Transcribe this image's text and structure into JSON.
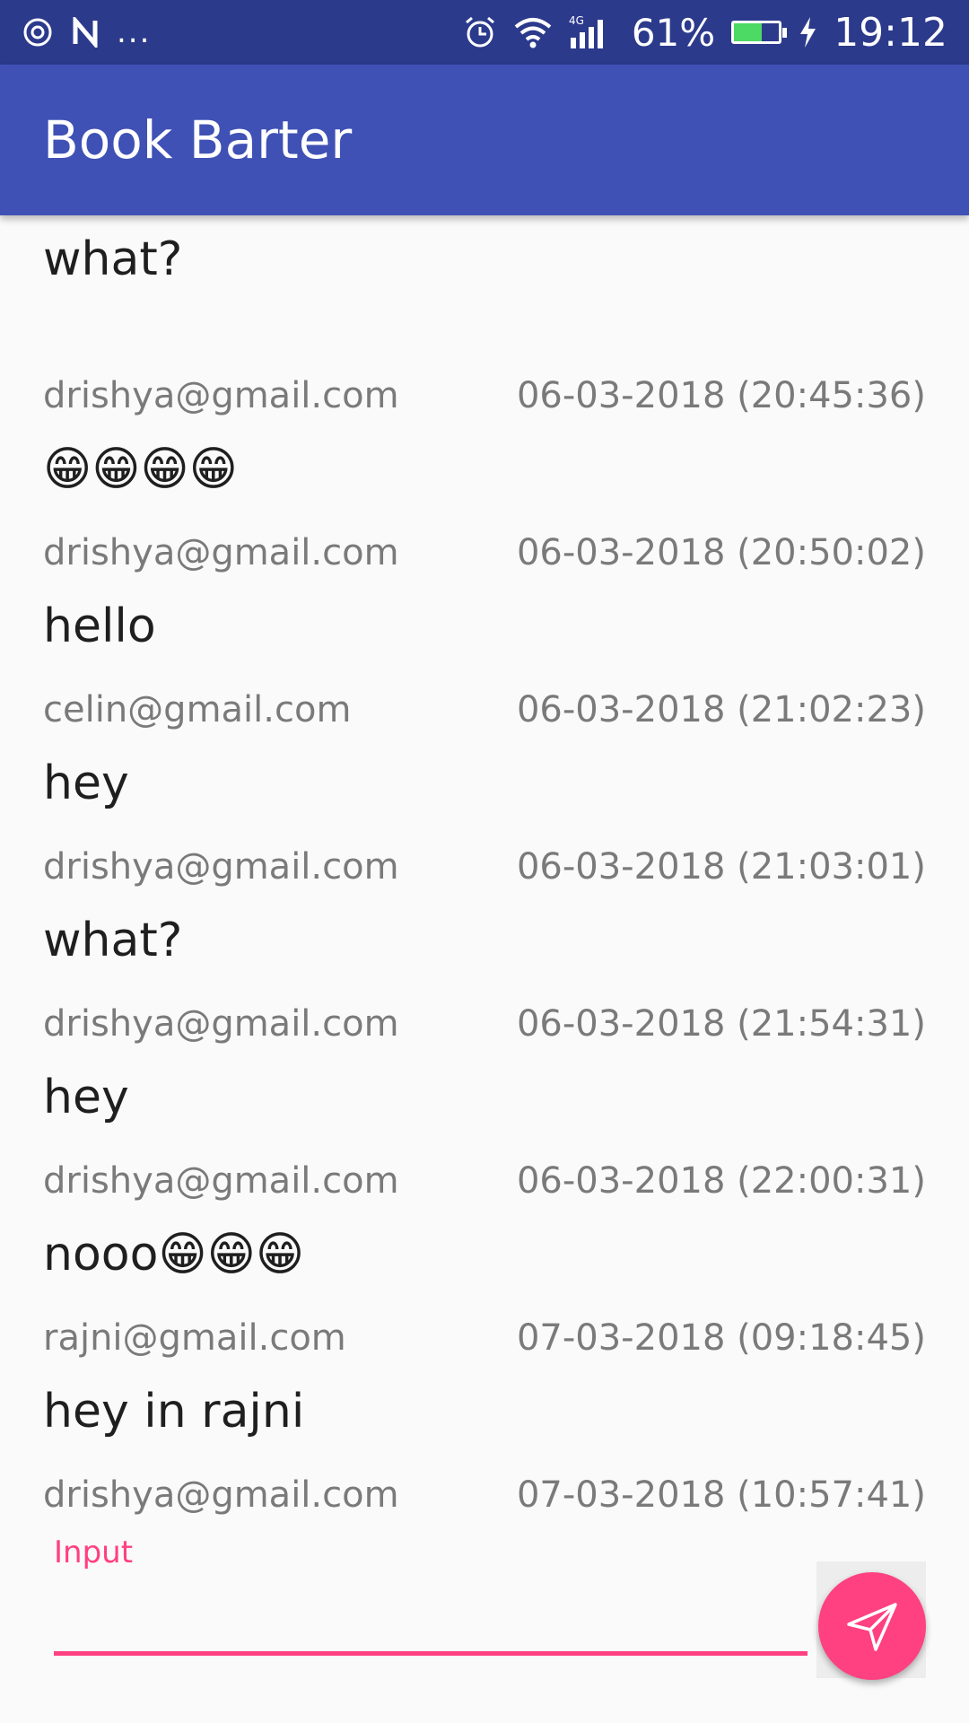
{
  "status_bar": {
    "battery_percent": "61%",
    "time": "19:12",
    "dots": "...",
    "network_label": "4G",
    "icons": [
      "sync-icon",
      "nfc-icon",
      "more-icon",
      "alarm-icon",
      "wifi-icon",
      "signal-icon",
      "battery-icon",
      "charging-icon"
    ],
    "battery_level": 0.61,
    "battery_color": "#4cd964"
  },
  "app_bar": {
    "title": "Book Barter",
    "color": "#3f51b5"
  },
  "messages": [
    {
      "sender": "",
      "time": "",
      "text": "what?"
    },
    {
      "sender": "drishya@gmail.com",
      "time": "06-03-2018 (20:45:36)",
      "text": "😁😁😁😁"
    },
    {
      "sender": "drishya@gmail.com",
      "time": "06-03-2018 (20:50:02)",
      "text": "hello"
    },
    {
      "sender": "celin@gmail.com",
      "time": "06-03-2018 (21:02:23)",
      "text": "hey"
    },
    {
      "sender": "drishya@gmail.com",
      "time": "06-03-2018 (21:03:01)",
      "text": "what?"
    },
    {
      "sender": "drishya@gmail.com",
      "time": "06-03-2018 (21:54:31)",
      "text": "hey"
    },
    {
      "sender": "drishya@gmail.com",
      "time": "06-03-2018 (22:00:31)",
      "text": "nooo😁😁😁"
    },
    {
      "sender": "rajni@gmail.com",
      "time": "07-03-2018 (09:18:45)",
      "text": "hey in rajni"
    },
    {
      "sender": "drishya@gmail.com",
      "time": "07-03-2018 (10:57:41)",
      "text": ""
    }
  ],
  "composer": {
    "label": "Input",
    "value": "",
    "accent_color": "#ff4081",
    "send_icon": "send-icon"
  }
}
